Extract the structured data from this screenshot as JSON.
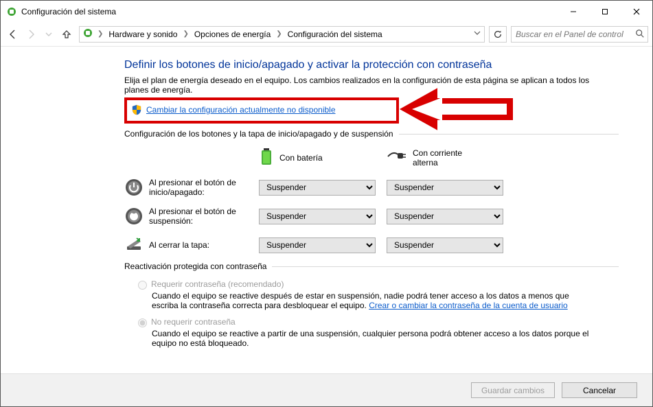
{
  "window": {
    "title": "Configuración del sistema"
  },
  "nav": {
    "crumbs": [
      "Hardware y sonido",
      "Opciones de energía",
      "Configuración del sistema"
    ],
    "search_placeholder": "Buscar en el Panel de control"
  },
  "page": {
    "heading": "Definir los botones de inicio/apagado y activar la protección con contraseña",
    "subdesc": "Elija el plan de energía deseado en el equipo. Los cambios realizados en la configuración de esta página se aplican a todos los planes de energía.",
    "admin_link": "Cambiar la configuración actualmente no disponible",
    "group1_label": "Configuración de los botones y la tapa de inicio/apagado y de suspensión",
    "col_battery": "Con batería",
    "col_ac": "Con corriente alterna",
    "rows": {
      "power": {
        "label": "Al presionar el botón de inicio/apagado:",
        "bat": "Suspender",
        "ac": "Suspender"
      },
      "sleep": {
        "label": "Al presionar el botón de suspensión:",
        "bat": "Suspender",
        "ac": "Suspender"
      },
      "lid": {
        "label": "Al cerrar la tapa:",
        "bat": "Suspender",
        "ac": "Suspender"
      }
    },
    "group2_label": "Reactivación protegida con contraseña",
    "opt1_title": "Requerir contraseña (recomendado)",
    "opt1_desc_a": "Cuando el equipo se reactive después de estar en suspensión, nadie podrá tener acceso a los datos a menos que escriba la contraseña correcta para desbloquear el equipo. ",
    "opt1_link": "Crear o cambiar la contraseña de la cuenta de usuario",
    "opt2_title": "No requerir contraseña",
    "opt2_desc": "Cuando el equipo se reactive a partir de una suspensión, cualquier persona podrá obtener acceso a los datos porque el equipo no está bloqueado."
  },
  "footer": {
    "save": "Guardar cambios",
    "cancel": "Cancelar"
  }
}
